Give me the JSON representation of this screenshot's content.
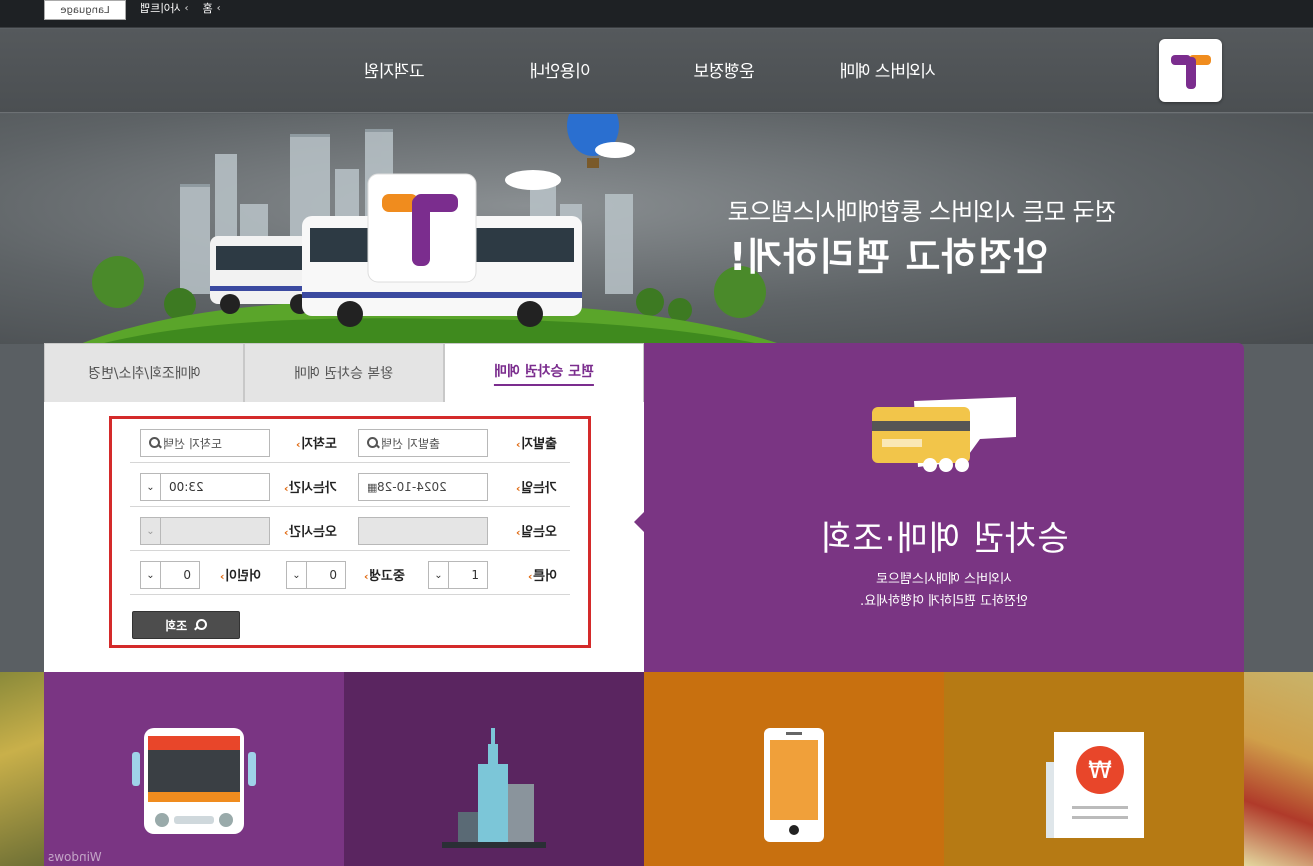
{
  "topbar": {
    "language_label": "Language",
    "home_label": "홈",
    "sitemap_label": "사이트맵"
  },
  "gnb": {
    "items": [
      "시외버스 예매",
      "운행정보",
      "이용안내",
      "고객지원"
    ],
    "logo_icon": "t-logo-icon"
  },
  "hero": {
    "subtitle": "전국 모든 시외버스 통합예매시스템으로",
    "title": "안전하고 편리하게!"
  },
  "tabs": [
    {
      "label": "편도 승차권 예매",
      "active": true
    },
    {
      "label": "왕복 승차권 예매",
      "active": false
    },
    {
      "label": "예매조회/취소/변경",
      "active": false
    }
  ],
  "form": {
    "departure_label": "출발지",
    "departure_placeholder": "출발지 선택",
    "arrival_label": "도착지",
    "arrival_placeholder": "도착지 선택",
    "go_date_label": "가는일",
    "go_date_value": "2024-10-28",
    "go_time_label": "가는시간",
    "go_time_value": "23:00",
    "return_date_label": "오는일",
    "return_time_label": "오는시간",
    "adult_label": "어른",
    "adult_value": "1",
    "student_label": "중고생",
    "student_value": "0",
    "child_label": "어린이",
    "child_value": "0",
    "search_button": "조회"
  },
  "promo": {
    "title": "승차권 예매·조회",
    "desc_line1": "시외버스 예매시스템으로",
    "desc_line2": "안전하고 편리하게 여행하세요.",
    "icon": "credit-card-hand-icon",
    "color": "#7a3583"
  },
  "tiles": [
    {
      "icon": "bus-icon",
      "color": "#7a3583"
    },
    {
      "icon": "building-icon",
      "color": "#5a2560"
    },
    {
      "icon": "mobile-phone-icon",
      "color": "#c8700f"
    },
    {
      "icon": "receipt-won-icon",
      "color": "#b67a14"
    }
  ],
  "watermark": "Windows"
}
